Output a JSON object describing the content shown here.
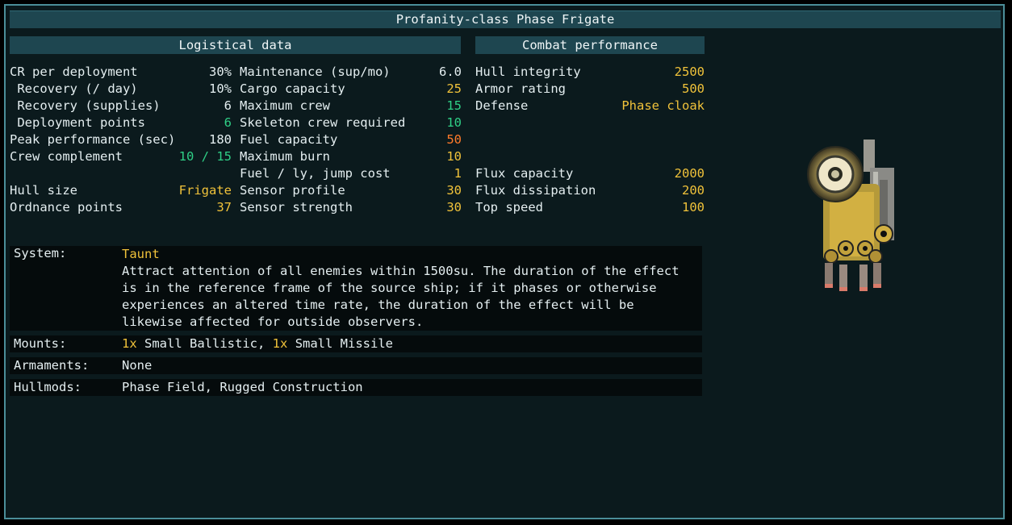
{
  "title": "Profanity-class Phase Frigate",
  "logistical": {
    "header": "Logistical data",
    "col1": [
      {
        "label": "CR per deployment",
        "value": "30%",
        "color": "white"
      },
      {
        "label": " Recovery (/ day)",
        "value": "10%",
        "color": "white"
      },
      {
        "label": " Recovery (supplies)",
        "value": "6",
        "color": "white"
      },
      {
        "label": " Deployment points",
        "value": "6",
        "color": "green"
      },
      {
        "label": "Peak performance (sec)",
        "value": "180",
        "color": "white"
      },
      {
        "label": "Crew complement",
        "value": "10 / 15",
        "color": "green"
      },
      {
        "label": "",
        "value": "",
        "color": "white"
      },
      {
        "label": "Hull size",
        "value": "Frigate",
        "color": "yellow"
      },
      {
        "label": "Ordnance points",
        "value": "37",
        "color": "yellow"
      }
    ],
    "col2": [
      {
        "label": "Maintenance (sup/mo)",
        "value": "6.0",
        "color": "white"
      },
      {
        "label": "Cargo capacity",
        "value": "25",
        "color": "yellow"
      },
      {
        "label": "Maximum crew",
        "value": "15",
        "color": "green"
      },
      {
        "label": "Skeleton crew required",
        "value": "10",
        "color": "green"
      },
      {
        "label": "Fuel capacity",
        "value": "50",
        "color": "orange"
      },
      {
        "label": "Maximum burn",
        "value": "10",
        "color": "yellow"
      },
      {
        "label": "Fuel / ly, jump cost",
        "value": "1",
        "color": "yellow"
      },
      {
        "label": "Sensor profile",
        "value": "30",
        "color": "yellow"
      },
      {
        "label": "Sensor strength",
        "value": "30",
        "color": "yellow"
      }
    ]
  },
  "combat": {
    "header": "Combat performance",
    "rows": [
      {
        "label": "Hull integrity",
        "value": "2500",
        "color": "yellow"
      },
      {
        "label": "Armor rating",
        "value": "500",
        "color": "yellow"
      },
      {
        "label": "Defense",
        "value": "Phase cloak",
        "color": "yellow"
      },
      {
        "label": "",
        "value": "",
        "color": "white"
      },
      {
        "label": "",
        "value": "",
        "color": "white"
      },
      {
        "label": "",
        "value": "",
        "color": "white"
      },
      {
        "label": "Flux capacity",
        "value": "2000",
        "color": "yellow"
      },
      {
        "label": "Flux dissipation",
        "value": "200",
        "color": "yellow"
      },
      {
        "label": "Top speed",
        "value": "100",
        "color": "yellow"
      }
    ]
  },
  "system": {
    "label": "System:",
    "name": "Taunt",
    "description": "Attract attention of all enemies within 1500su. The duration of the effect is in the reference frame of the source ship; if it phases or otherwise experiences an altered time rate, the duration of the effect will be likewise affected for outside observers."
  },
  "mounts": {
    "label": "Mounts:",
    "m1_count": "1x",
    "m1_text": "Small Ballistic,",
    "m2_count": "1x",
    "m2_text": "Small Missile"
  },
  "armaments": {
    "label": "Armaments:",
    "value": "None"
  },
  "hullmods": {
    "label": "Hullmods:",
    "value": "Phase Field, Rugged Construction"
  },
  "colors": {
    "yellow": "#f0c23a",
    "green": "#2fcf86",
    "orange": "#ff7a2a",
    "white": "#e4eef0",
    "header": "#1e4650",
    "border": "#4b8e99"
  },
  "ship_image": "ship-sprite-icon"
}
